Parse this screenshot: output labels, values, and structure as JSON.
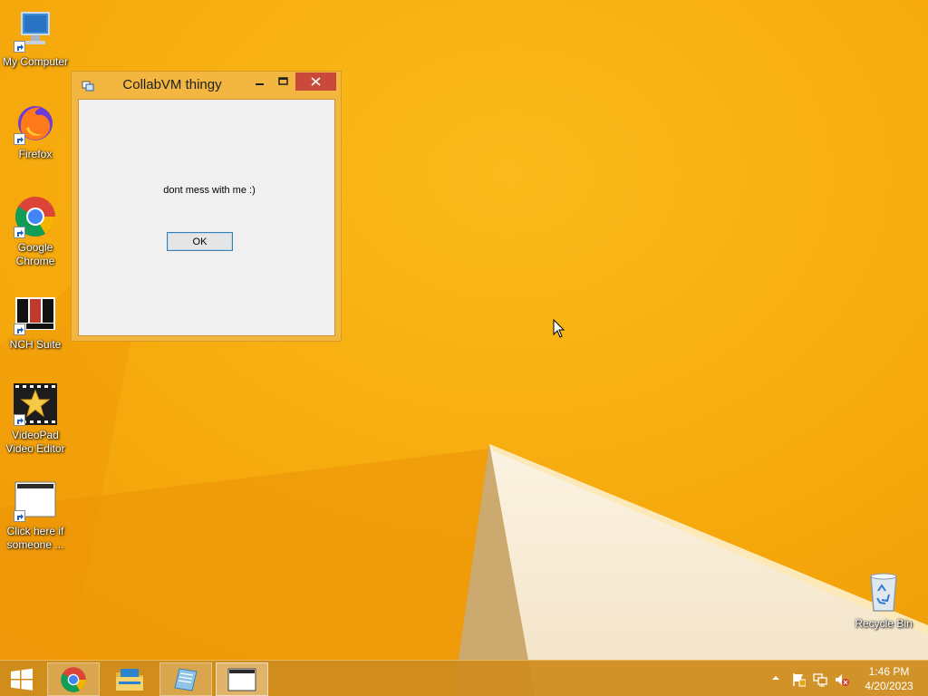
{
  "desktop": {
    "icons": [
      {
        "label": "My Computer"
      },
      {
        "label": "Firefox"
      },
      {
        "label": "Google\nChrome"
      },
      {
        "label": "NCH Suite"
      },
      {
        "label": "VideoPad\nVideo Editor"
      },
      {
        "label": "Click here if\nsomeone ..."
      }
    ],
    "recycle_bin": {
      "label": "Recycle Bin"
    }
  },
  "dialog": {
    "title": "CollabVM thingy",
    "message": "dont mess with me :)",
    "ok_label": "OK",
    "close_color": "#c94a3a"
  },
  "taskbar": {
    "items": [
      "start-icon",
      "chrome-icon",
      "file-explorer-icon",
      "notepad-icon",
      "window-icon"
    ],
    "clock": {
      "time": "1:46 PM",
      "date": "4/20/2023"
    }
  },
  "colors": {
    "accent": "#f5a80d",
    "taskbar": "#cd8c1e"
  }
}
